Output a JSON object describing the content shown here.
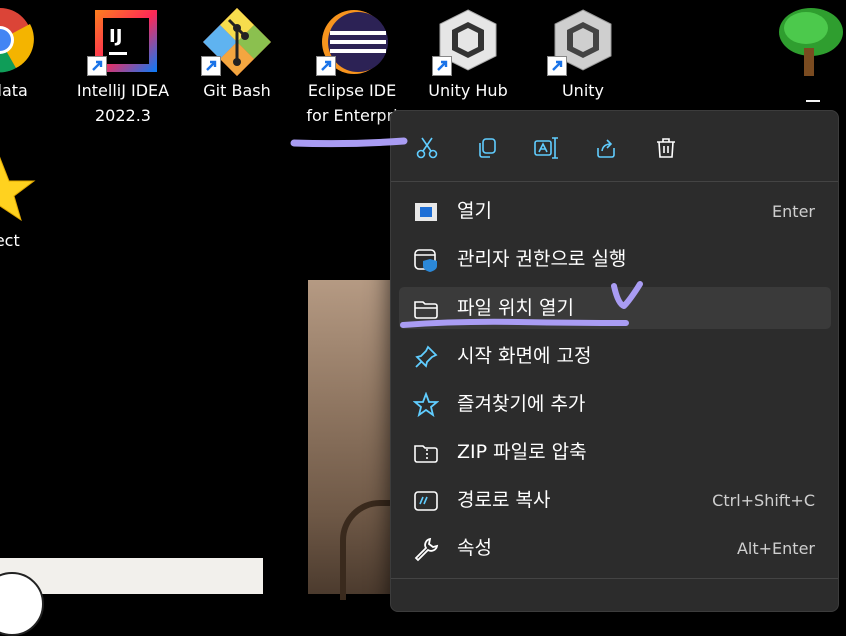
{
  "desktop": {
    "icons": [
      {
        "label": "uxdata"
      },
      {
        "label": "IntelliJ IDEA\n2022.3"
      },
      {
        "label": "Git Bash"
      },
      {
        "label": "Eclipse IDE\nfor Enterpri"
      },
      {
        "label": "Unity Hub"
      },
      {
        "label": "Unity"
      },
      {
        "label": "bject"
      }
    ]
  },
  "menu": {
    "toolbar": {
      "cut": "cut-icon",
      "copy": "copy-icon",
      "rename": "rename-icon",
      "share": "share-icon",
      "delete": "trash-icon"
    },
    "items": [
      {
        "label": "열기",
        "shortcut": "Enter",
        "icon": "open-window-icon"
      },
      {
        "label": "관리자 권한으로 실행",
        "shortcut": "",
        "icon": "admin-shield-icon"
      },
      {
        "label": "파일 위치 열기",
        "shortcut": "",
        "icon": "folder-icon"
      },
      {
        "label": "시작 화면에 고정",
        "shortcut": "",
        "icon": "pin-icon"
      },
      {
        "label": "즐겨찾기에 추가",
        "shortcut": "",
        "icon": "star-icon"
      },
      {
        "label": "ZIP 파일로 압축",
        "shortcut": "",
        "icon": "zip-folder-icon"
      },
      {
        "label": "경로로 복사",
        "shortcut": "Ctrl+Shift+C",
        "icon": "copy-path-icon"
      },
      {
        "label": "속성",
        "shortcut": "Alt+Enter",
        "icon": "wrench-icon"
      }
    ]
  },
  "colors": {
    "accent": "#60cdff",
    "annotation": "#a99cf3"
  }
}
